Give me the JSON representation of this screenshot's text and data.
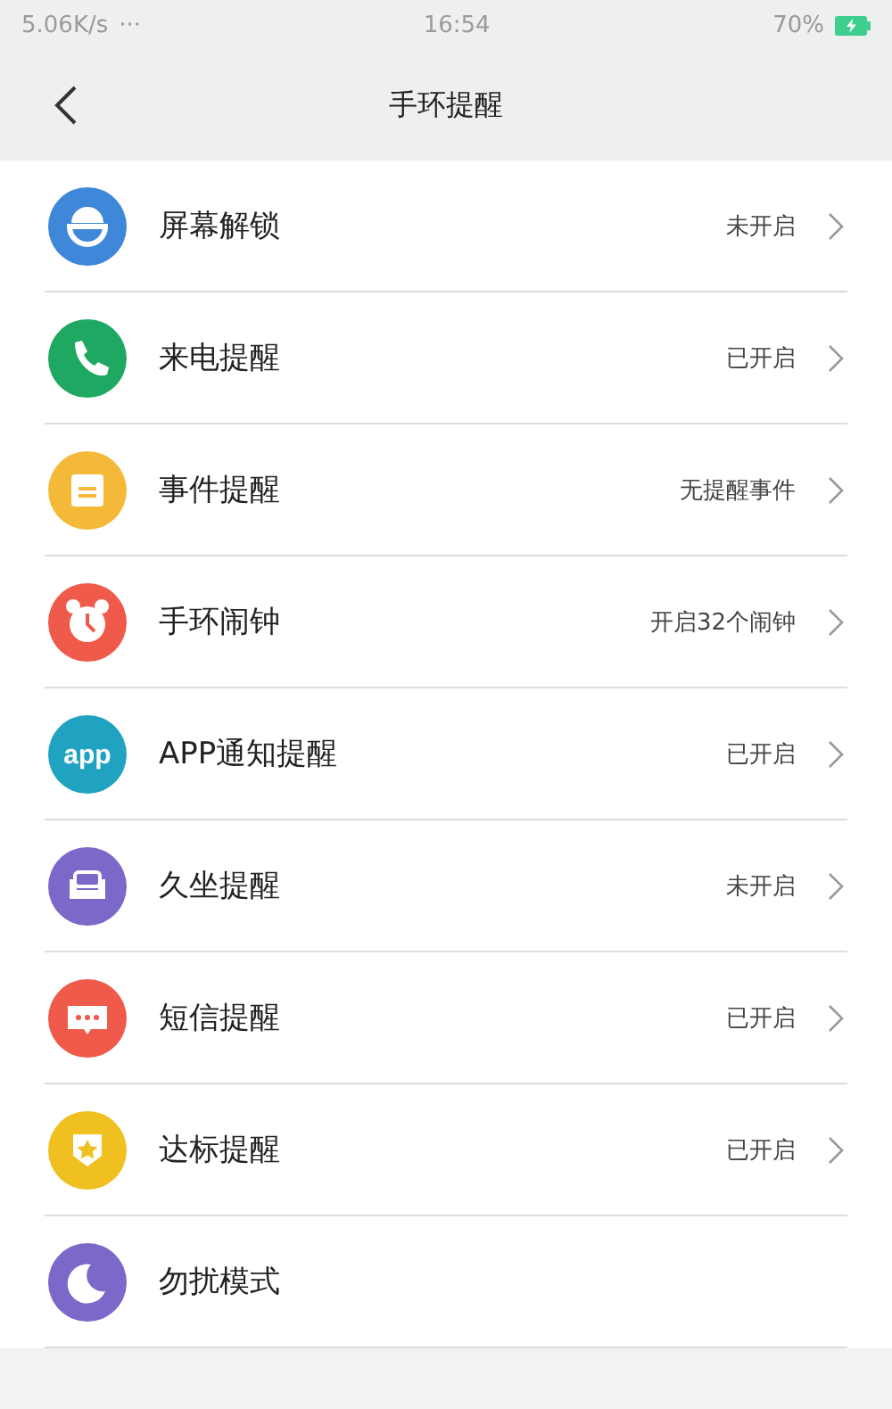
{
  "status_bar": {
    "speed": "5.06K/s",
    "dots": "···",
    "time": "16:54",
    "battery": "70%"
  },
  "header": {
    "title": "手环提醒"
  },
  "items": [
    {
      "kind": "lock",
      "color": "#3f87d9",
      "label": "屏幕解锁",
      "value": "未开启"
    },
    {
      "kind": "phone",
      "color": "#1fa862",
      "label": "来电提醒",
      "value": "已开启"
    },
    {
      "kind": "calendar",
      "color": "#f5b93a",
      "label": "事件提醒",
      "value": "无提醒事件"
    },
    {
      "kind": "alarm",
      "color": "#ef5a4b",
      "label": "手环闹钟",
      "value": "开启32个闹钟"
    },
    {
      "kind": "app",
      "color": "#1fa3c0",
      "icon_text": "app",
      "label": "APP通知提醒",
      "value": "已开启"
    },
    {
      "kind": "sofa",
      "color": "#7b68c8",
      "label": "久坐提醒",
      "value": "未开启"
    },
    {
      "kind": "message",
      "color": "#ef5a4b",
      "label": "短信提醒",
      "value": "已开启"
    },
    {
      "kind": "badge",
      "color": "#f0c020",
      "label": "达标提醒",
      "value": "已开启"
    },
    {
      "kind": "moon",
      "color": "#7b68c8",
      "label": "勿扰模式"
    }
  ]
}
